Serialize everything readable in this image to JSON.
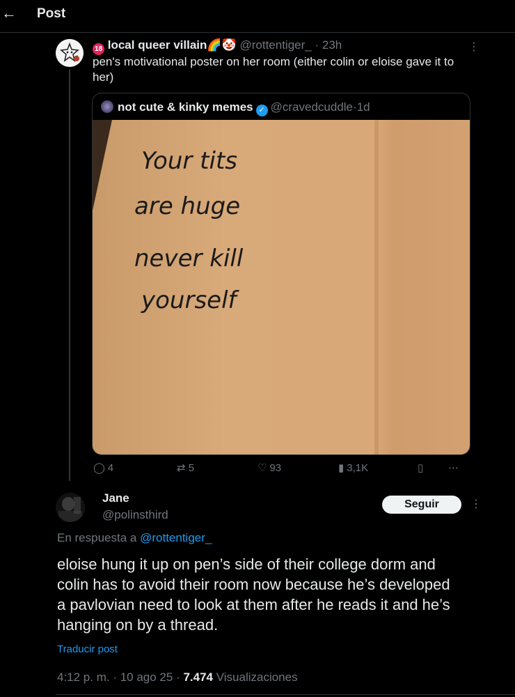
{
  "header": {
    "back_icon": "←",
    "title": "Post"
  },
  "tweet": {
    "badge_18": "18",
    "author_name": "local queer villain",
    "author_emojis": "🌈🤡",
    "handle": "@rottentiger_",
    "separator": "·",
    "time": "23h",
    "more": "⋮",
    "text": "pen's motivational poster on her room (either colin or eloise gave it to her)"
  },
  "quote": {
    "author_name": "not cute & kinky memes",
    "verified_icon": "✓",
    "handle": "@cravedcuddle",
    "separator": "·",
    "time": "1d",
    "image_text": [
      "Your tits",
      "are huge",
      "never kill",
      "yourself"
    ]
  },
  "actions": {
    "replies": "4",
    "reposts": "5",
    "likes": "93",
    "views": "3,1K",
    "icons": {
      "reply": "reply-icon",
      "repost": "repost-icon",
      "like": "heart-icon",
      "views": "views-icon",
      "bookmark": "bookmark-icon",
      "share": "share-icon"
    }
  },
  "reply": {
    "name": "Jane",
    "handle": "@polinsthird",
    "follow_label": "Seguir",
    "more": "⋮",
    "reply_prefix": "En respuesta a",
    "reply_to": "@rottentiger_",
    "text": "eloise hung it up on pen’s side of their college dorm and colin has to avoid their room now because he’s developed a pavlovian need to look at them after he reads it and he’s hanging on by a thread.",
    "translate": "Traducir post",
    "timestamp": "4:12 p. m. · 10 ago 25 · ",
    "views_count": "7.474",
    "views_label": " Visualizaciones"
  },
  "colors": {
    "accent": "#1d9bf0",
    "muted": "#71767b",
    "text": "#e7e9ea",
    "border": "#2f3336"
  }
}
